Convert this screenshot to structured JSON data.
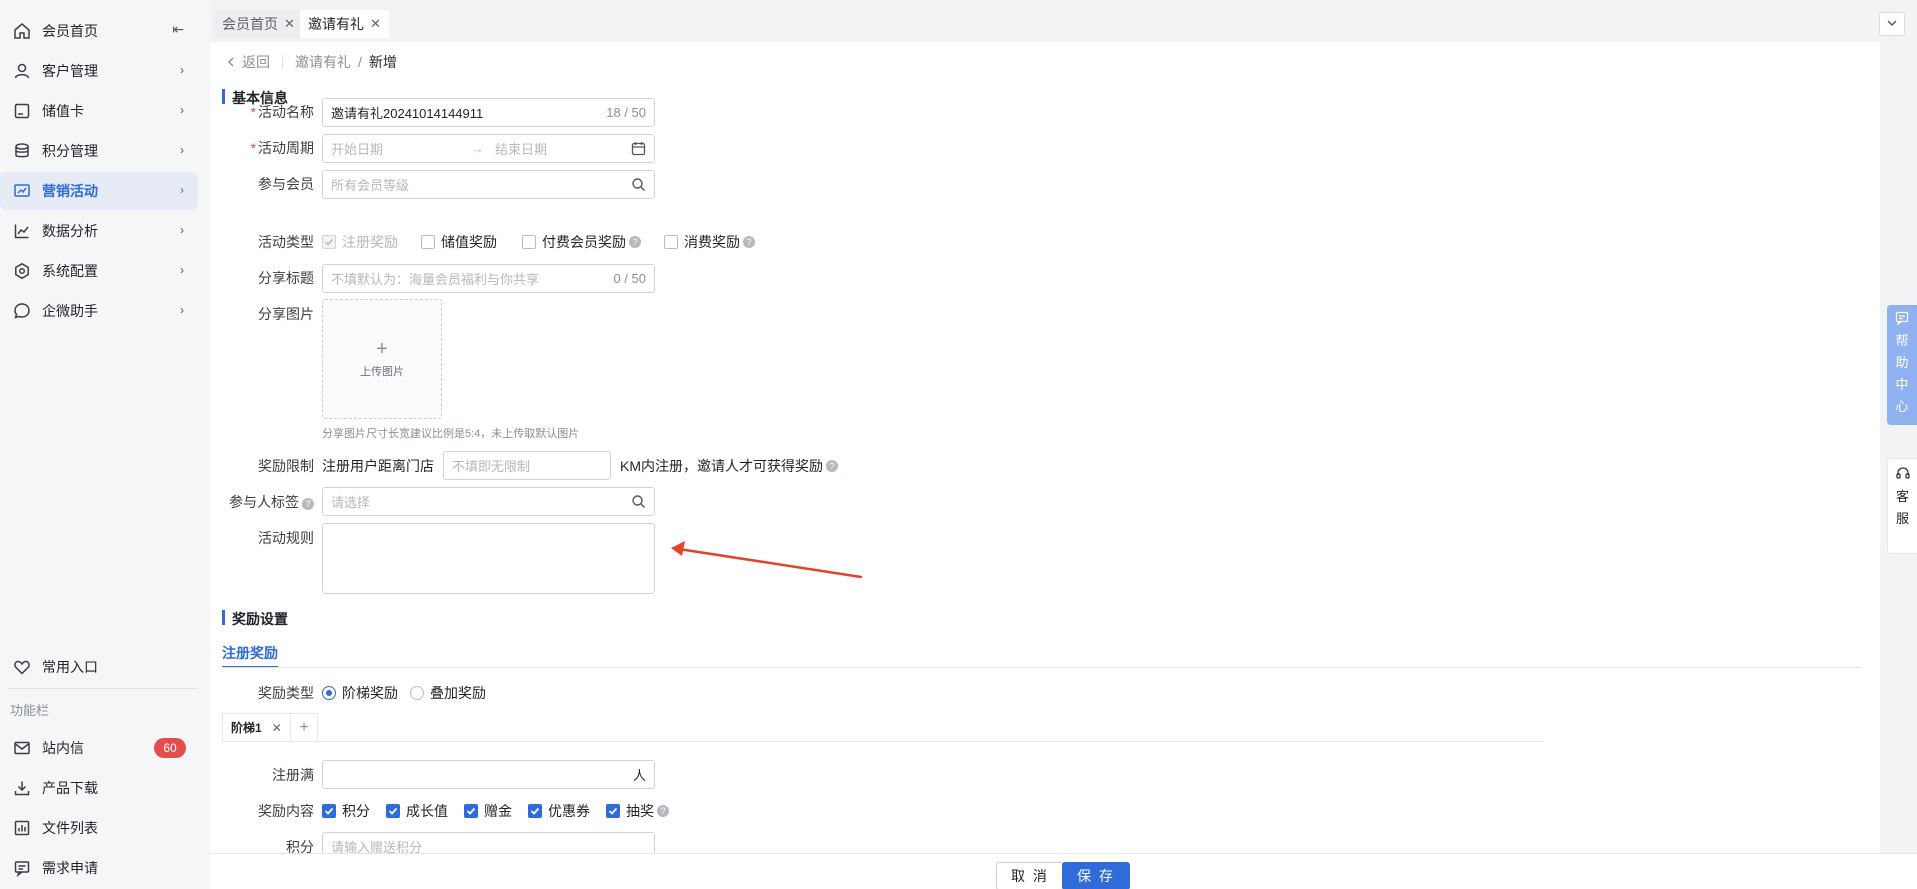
{
  "sidebar": {
    "items": [
      {
        "label": "会员首页",
        "icon": "home-icon"
      },
      {
        "label": "客户管理",
        "icon": "user-icon"
      },
      {
        "label": "储值卡",
        "icon": "card-icon"
      },
      {
        "label": "积分管理",
        "icon": "database-icon"
      },
      {
        "label": "营销活动",
        "icon": "chart-board-icon"
      },
      {
        "label": "数据分析",
        "icon": "line-chart-icon"
      },
      {
        "label": "系统配置",
        "icon": "gear-icon"
      },
      {
        "label": "企微助手",
        "icon": "chat-icon"
      }
    ],
    "common_entry": "常用入口",
    "section_label": "功能栏",
    "bottom_items": [
      {
        "label": "站内信",
        "icon": "mail-icon",
        "badge": "60"
      },
      {
        "label": "产品下载",
        "icon": "download-icon"
      },
      {
        "label": "文件列表",
        "icon": "file-list-icon"
      },
      {
        "label": "需求申请",
        "icon": "request-icon"
      }
    ]
  },
  "tabs": [
    {
      "label": "会员首页",
      "active": false
    },
    {
      "label": "邀请有礼",
      "active": true
    }
  ],
  "breadcrumb": {
    "back": "返回",
    "parent": "邀请有礼",
    "separator": "/",
    "current": "新增"
  },
  "basic_section": {
    "title": "基本信息"
  },
  "form": {
    "name": {
      "label": "活动名称",
      "value": "邀请有礼20241014144911",
      "count": "18 / 50"
    },
    "period": {
      "label": "活动周期",
      "start_placeholder": "开始日期",
      "arrow": "→",
      "end_placeholder": "结束日期"
    },
    "members": {
      "label": "参与会员",
      "placeholder": "所有会员等级"
    },
    "type": {
      "label": "活动类型",
      "options": [
        "注册奖励",
        "储值奖励",
        "付费会员奖励",
        "消费奖励"
      ]
    },
    "share_title": {
      "label": "分享标题",
      "placeholder": "不填默认为：海量会员福利与你共享",
      "count": "0 / 50"
    },
    "share_image": {
      "label": "分享图片",
      "upload_text": "上传图片",
      "hint": "分享图片尺寸长宽建议比例是5:4，未上传取默认图片"
    },
    "limit": {
      "label": "奖励限制",
      "prefix": "注册用户距离门店",
      "placeholder": "不填即无限制",
      "suffix": "KM内注册，邀请人才可获得奖励"
    },
    "tags": {
      "label": "参与人标签",
      "placeholder": "请选择"
    },
    "rules": {
      "label": "活动规则"
    }
  },
  "reward_section": {
    "title": "奖励设置",
    "subtab": "注册奖励",
    "type_label": "奖励类型",
    "type_options": [
      "阶梯奖励",
      "叠加奖励"
    ],
    "tier_tab": "阶梯1",
    "full_label": "注册满",
    "full_unit": "人",
    "content_label": "奖励内容",
    "content_options": [
      "积分",
      "成长值",
      "赠金",
      "优惠券",
      "抽奖"
    ],
    "points_label": "积分",
    "points_placeholder": "请输入赠送积分"
  },
  "footer": {
    "cancel": "取 消",
    "save": "保 存"
  },
  "floating": {
    "help": [
      "帮",
      "助",
      "中",
      "心"
    ],
    "service": [
      "客",
      "服"
    ]
  },
  "colors": {
    "accent": "#2f6bd9",
    "annotation_arrow": "#e0442b",
    "badge": "#e34d4d"
  }
}
